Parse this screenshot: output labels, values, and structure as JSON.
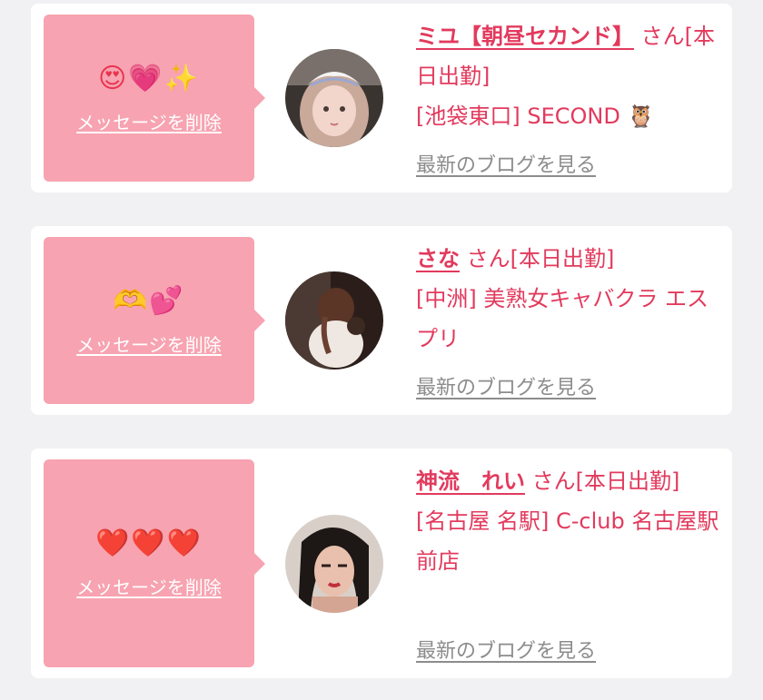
{
  "messages": [
    {
      "emoji": "😍💗✨",
      "delete_label": "メッセージを削除",
      "name": "ミユ【朝昼セカンド】",
      "suffix": " さん[本日出勤]",
      "shop": "[池袋東口] SECOND 🦉",
      "blog_label": "最新のブログを見る"
    },
    {
      "emoji": "🫶💕",
      "delete_label": "メッセージを削除",
      "name": "さな",
      "suffix": " さん[本日出勤]",
      "shop": "[中洲] 美熟女キャバクラ エスプリ",
      "blog_label": "最新のブログを見る"
    },
    {
      "emoji": "❤️❤️❤️",
      "delete_label": "メッセージを削除",
      "name": "神流　れい",
      "suffix": " さん[本日出勤]",
      "shop": "[名古屋 名駅] C-club 名古屋駅前店",
      "blog_label": "最新のブログを見る"
    }
  ]
}
